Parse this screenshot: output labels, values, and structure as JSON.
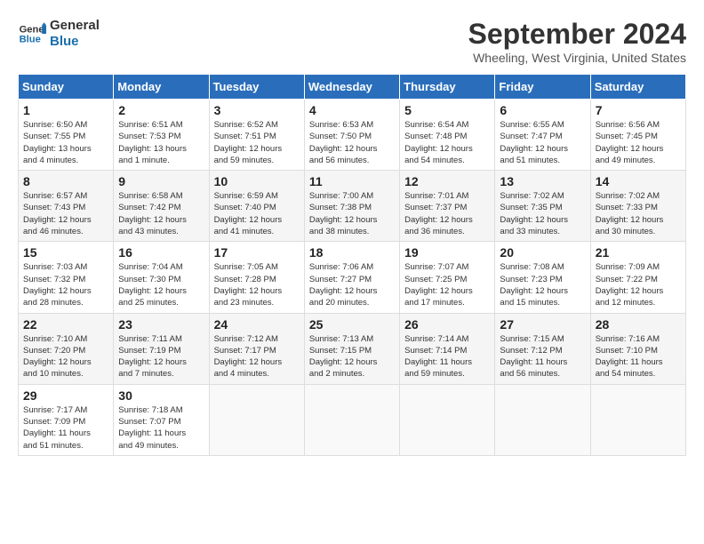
{
  "logo": {
    "line1": "General",
    "line2": "Blue"
  },
  "title": "September 2024",
  "location": "Wheeling, West Virginia, United States",
  "weekdays": [
    "Sunday",
    "Monday",
    "Tuesday",
    "Wednesday",
    "Thursday",
    "Friday",
    "Saturday"
  ],
  "weeks": [
    [
      {
        "day": "1",
        "info": "Sunrise: 6:50 AM\nSunset: 7:55 PM\nDaylight: 13 hours\nand 4 minutes."
      },
      {
        "day": "2",
        "info": "Sunrise: 6:51 AM\nSunset: 7:53 PM\nDaylight: 13 hours\nand 1 minute."
      },
      {
        "day": "3",
        "info": "Sunrise: 6:52 AM\nSunset: 7:51 PM\nDaylight: 12 hours\nand 59 minutes."
      },
      {
        "day": "4",
        "info": "Sunrise: 6:53 AM\nSunset: 7:50 PM\nDaylight: 12 hours\nand 56 minutes."
      },
      {
        "day": "5",
        "info": "Sunrise: 6:54 AM\nSunset: 7:48 PM\nDaylight: 12 hours\nand 54 minutes."
      },
      {
        "day": "6",
        "info": "Sunrise: 6:55 AM\nSunset: 7:47 PM\nDaylight: 12 hours\nand 51 minutes."
      },
      {
        "day": "7",
        "info": "Sunrise: 6:56 AM\nSunset: 7:45 PM\nDaylight: 12 hours\nand 49 minutes."
      }
    ],
    [
      {
        "day": "8",
        "info": "Sunrise: 6:57 AM\nSunset: 7:43 PM\nDaylight: 12 hours\nand 46 minutes."
      },
      {
        "day": "9",
        "info": "Sunrise: 6:58 AM\nSunset: 7:42 PM\nDaylight: 12 hours\nand 43 minutes."
      },
      {
        "day": "10",
        "info": "Sunrise: 6:59 AM\nSunset: 7:40 PM\nDaylight: 12 hours\nand 41 minutes."
      },
      {
        "day": "11",
        "info": "Sunrise: 7:00 AM\nSunset: 7:38 PM\nDaylight: 12 hours\nand 38 minutes."
      },
      {
        "day": "12",
        "info": "Sunrise: 7:01 AM\nSunset: 7:37 PM\nDaylight: 12 hours\nand 36 minutes."
      },
      {
        "day": "13",
        "info": "Sunrise: 7:02 AM\nSunset: 7:35 PM\nDaylight: 12 hours\nand 33 minutes."
      },
      {
        "day": "14",
        "info": "Sunrise: 7:02 AM\nSunset: 7:33 PM\nDaylight: 12 hours\nand 30 minutes."
      }
    ],
    [
      {
        "day": "15",
        "info": "Sunrise: 7:03 AM\nSunset: 7:32 PM\nDaylight: 12 hours\nand 28 minutes."
      },
      {
        "day": "16",
        "info": "Sunrise: 7:04 AM\nSunset: 7:30 PM\nDaylight: 12 hours\nand 25 minutes."
      },
      {
        "day": "17",
        "info": "Sunrise: 7:05 AM\nSunset: 7:28 PM\nDaylight: 12 hours\nand 23 minutes."
      },
      {
        "day": "18",
        "info": "Sunrise: 7:06 AM\nSunset: 7:27 PM\nDaylight: 12 hours\nand 20 minutes."
      },
      {
        "day": "19",
        "info": "Sunrise: 7:07 AM\nSunset: 7:25 PM\nDaylight: 12 hours\nand 17 minutes."
      },
      {
        "day": "20",
        "info": "Sunrise: 7:08 AM\nSunset: 7:23 PM\nDaylight: 12 hours\nand 15 minutes."
      },
      {
        "day": "21",
        "info": "Sunrise: 7:09 AM\nSunset: 7:22 PM\nDaylight: 12 hours\nand 12 minutes."
      }
    ],
    [
      {
        "day": "22",
        "info": "Sunrise: 7:10 AM\nSunset: 7:20 PM\nDaylight: 12 hours\nand 10 minutes."
      },
      {
        "day": "23",
        "info": "Sunrise: 7:11 AM\nSunset: 7:19 PM\nDaylight: 12 hours\nand 7 minutes."
      },
      {
        "day": "24",
        "info": "Sunrise: 7:12 AM\nSunset: 7:17 PM\nDaylight: 12 hours\nand 4 minutes."
      },
      {
        "day": "25",
        "info": "Sunrise: 7:13 AM\nSunset: 7:15 PM\nDaylight: 12 hours\nand 2 minutes."
      },
      {
        "day": "26",
        "info": "Sunrise: 7:14 AM\nSunset: 7:14 PM\nDaylight: 11 hours\nand 59 minutes."
      },
      {
        "day": "27",
        "info": "Sunrise: 7:15 AM\nSunset: 7:12 PM\nDaylight: 11 hours\nand 56 minutes."
      },
      {
        "day": "28",
        "info": "Sunrise: 7:16 AM\nSunset: 7:10 PM\nDaylight: 11 hours\nand 54 minutes."
      }
    ],
    [
      {
        "day": "29",
        "info": "Sunrise: 7:17 AM\nSunset: 7:09 PM\nDaylight: 11 hours\nand 51 minutes."
      },
      {
        "day": "30",
        "info": "Sunrise: 7:18 AM\nSunset: 7:07 PM\nDaylight: 11 hours\nand 49 minutes."
      },
      {
        "day": "",
        "info": ""
      },
      {
        "day": "",
        "info": ""
      },
      {
        "day": "",
        "info": ""
      },
      {
        "day": "",
        "info": ""
      },
      {
        "day": "",
        "info": ""
      }
    ]
  ]
}
